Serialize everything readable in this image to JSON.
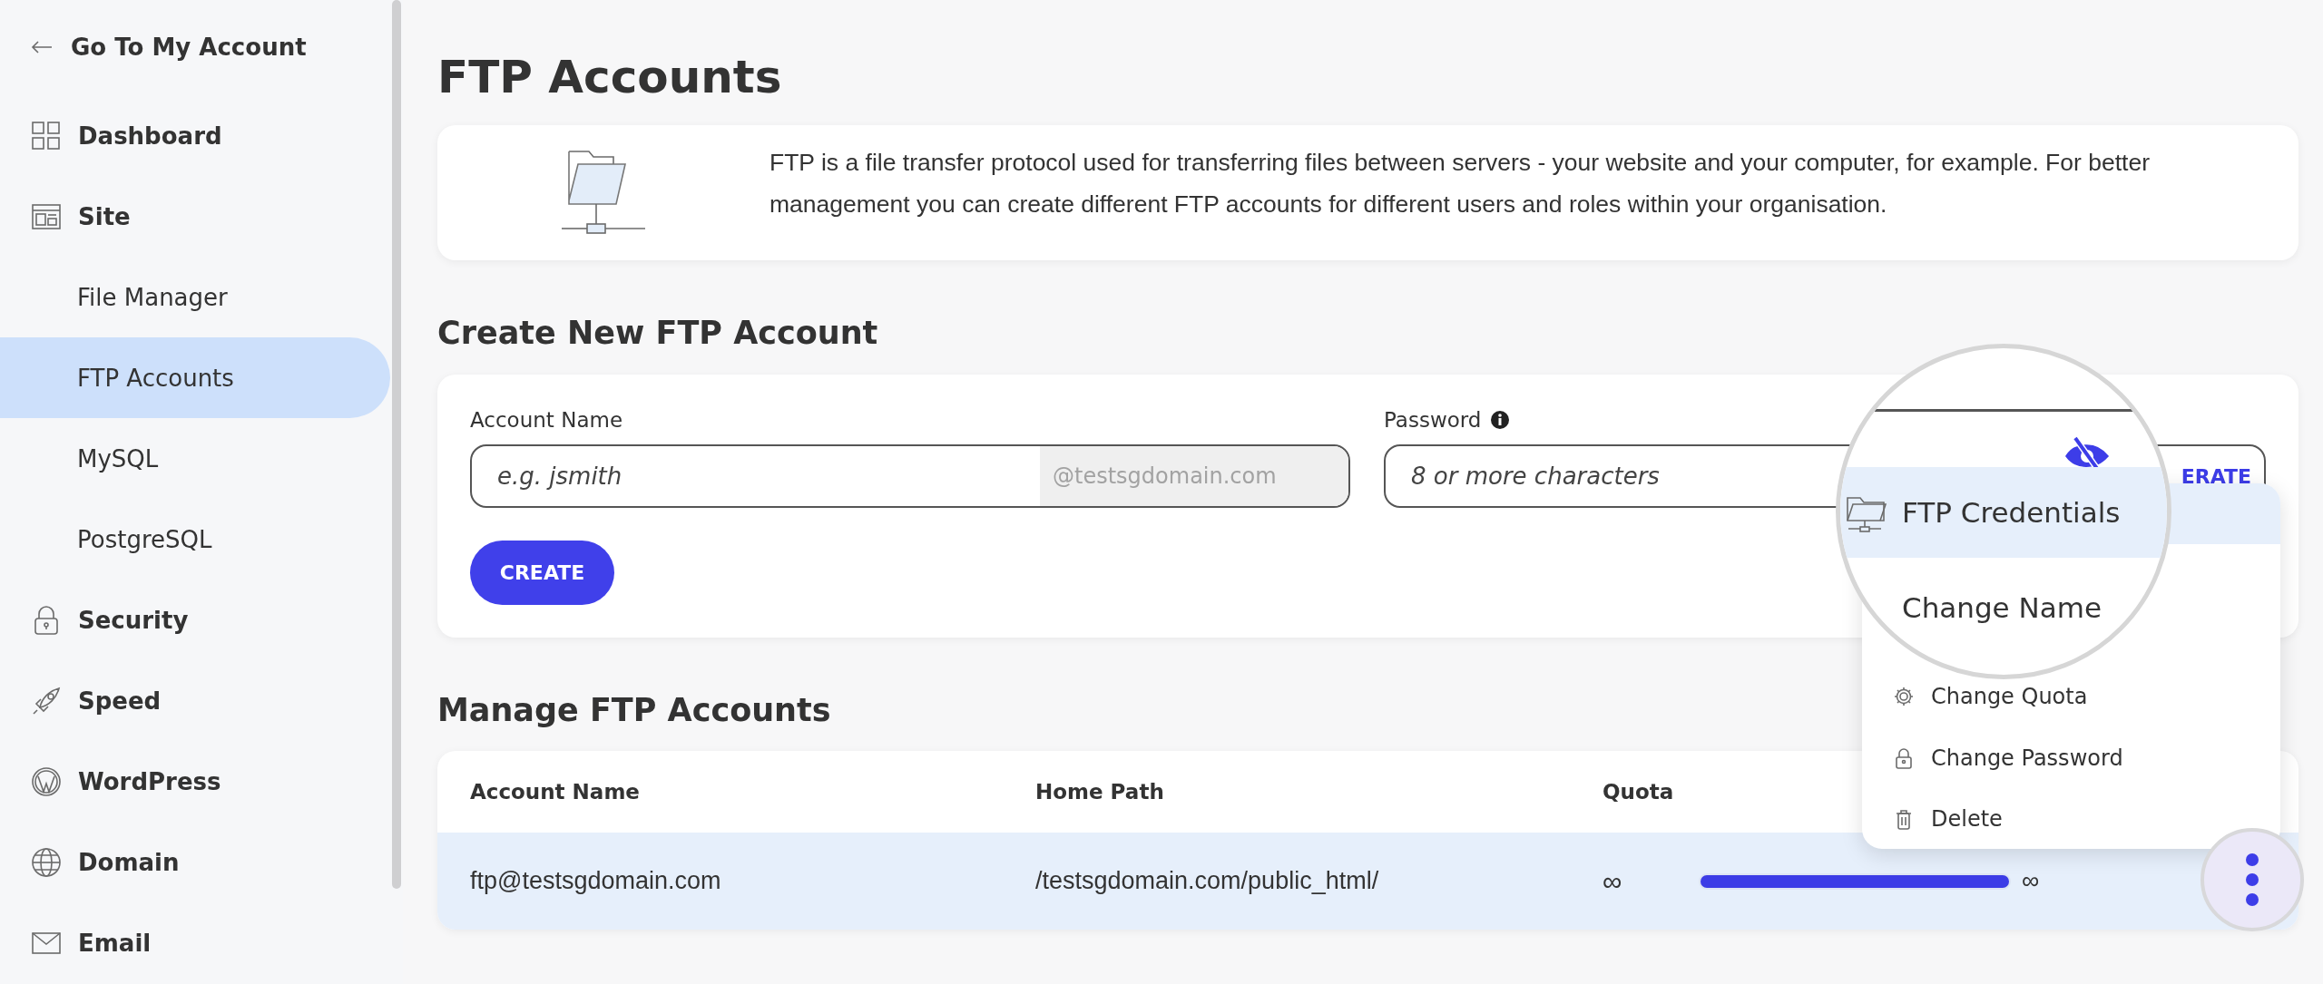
{
  "sidebar": {
    "back_link": "Go To My Account",
    "items": [
      {
        "label": "Dashboard",
        "selected": false
      },
      {
        "label": "Site",
        "selected": false,
        "children": [
          {
            "label": "File Manager",
            "selected": false
          },
          {
            "label": "FTP Accounts",
            "selected": true
          },
          {
            "label": "MySQL",
            "selected": false
          },
          {
            "label": "PostgreSQL",
            "selected": false
          }
        ]
      },
      {
        "label": "Security",
        "selected": false
      },
      {
        "label": "Speed",
        "selected": false
      },
      {
        "label": "WordPress",
        "selected": false
      },
      {
        "label": "Domain",
        "selected": false
      },
      {
        "label": "Email",
        "selected": false
      }
    ]
  },
  "page_title": "FTP Accounts",
  "intro": {
    "text": "FTP is a file transfer protocol used for transferring files between servers - your website and your computer, for example. For better management you can create different FTP accounts for different users and roles within your organisation."
  },
  "create_section": {
    "title": "Create New FTP Account",
    "account_name": {
      "label": "Account Name",
      "placeholder": "e.g. jsmith",
      "suffix": "@testsgdomain.com"
    },
    "password": {
      "label": "Password",
      "placeholder": "8 or more characters",
      "generate_button": "ERATE"
    },
    "create_button": "CREATE"
  },
  "manage_section": {
    "title": "Manage FTP Accounts",
    "table": {
      "columns": [
        "Account Name",
        "Home Path",
        "Quota"
      ],
      "rows": [
        {
          "account_name": "ftp@testsgdomain.com",
          "home_path": "/testsgdomain.com/public_html/",
          "quota_used": "∞",
          "level": 1,
          "quota_limit": "∞",
          "selected": true
        }
      ]
    }
  },
  "actions_menu": {
    "items": [
      {
        "label": "FTP Credentials",
        "selected": true,
        "magnified": true
      },
      {
        "label": "Change Name",
        "selected": false,
        "magnified": true
      },
      {
        "label": "Change Quota",
        "selected": false,
        "magnified": false
      },
      {
        "label": "Change Password",
        "selected": false,
        "magnified": false
      },
      {
        "label": "Delete",
        "selected": false,
        "magnified": false
      }
    ]
  }
}
